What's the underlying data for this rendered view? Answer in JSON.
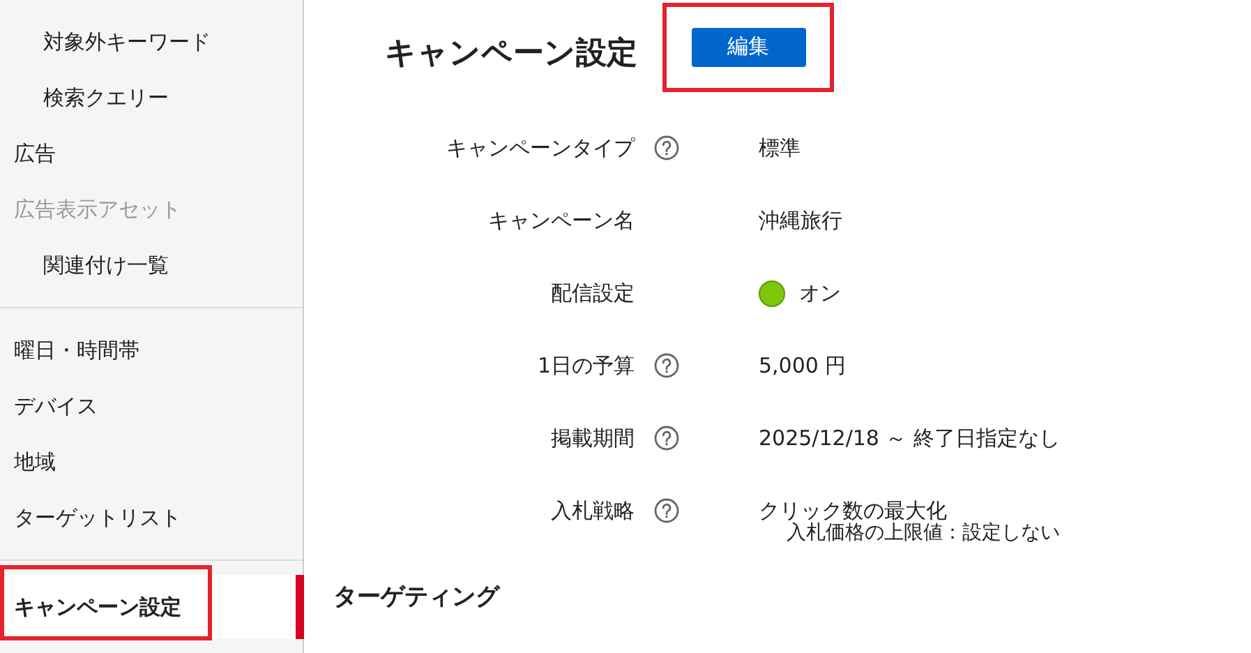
{
  "sidebar": {
    "sections": [
      {
        "items": [
          {
            "children": [
              {
                "label": "対象外キーワード",
                "selected": false,
                "disabled": false
              },
              {
                "label": "検索クエリー",
                "selected": false,
                "disabled": false
              }
            ]
          },
          {
            "label": "広告",
            "selected": false,
            "disabled": false
          },
          {
            "label": "広告表示アセット",
            "selected": false,
            "disabled": true,
            "children": [
              {
                "label": "関連付け一覧",
                "selected": false,
                "disabled": false
              }
            ]
          }
        ]
      },
      {
        "items": [
          {
            "label": "曜日・時間帯",
            "selected": false,
            "disabled": false
          },
          {
            "label": "デバイス",
            "selected": false,
            "disabled": false
          },
          {
            "label": "地域",
            "selected": false,
            "disabled": false
          },
          {
            "label": "ターゲットリスト",
            "selected": false,
            "disabled": false
          }
        ]
      },
      {
        "items": [
          {
            "label": "キャンペーン設定",
            "selected": true,
            "disabled": false,
            "highlighted": true
          }
        ]
      }
    ]
  },
  "header": {
    "title": "キャンペーン設定",
    "edit_button": {
      "label": "編集",
      "highlighted": true
    }
  },
  "settings": [
    {
      "label": "キャンペーンタイプ",
      "help": true,
      "kind": "text",
      "value": "標準"
    },
    {
      "label": "キャンペーン名",
      "help": false,
      "kind": "text",
      "value": "沖縄旅行"
    },
    {
      "label": "配信設定",
      "help": false,
      "kind": "status",
      "value": "オン",
      "color": "#7ac70c"
    },
    {
      "label": "1日の予算",
      "help": true,
      "kind": "text",
      "value": "5,000 円"
    },
    {
      "label": "掲載期間",
      "help": true,
      "kind": "text",
      "value": "2025/12/18 ～ 終了日指定なし"
    },
    {
      "label": "入札戦略",
      "help": true,
      "kind": "text",
      "value": "クリック数の最大化",
      "note": "入札価格の上限値：設定しない"
    }
  ],
  "section_title": "ターゲティング"
}
